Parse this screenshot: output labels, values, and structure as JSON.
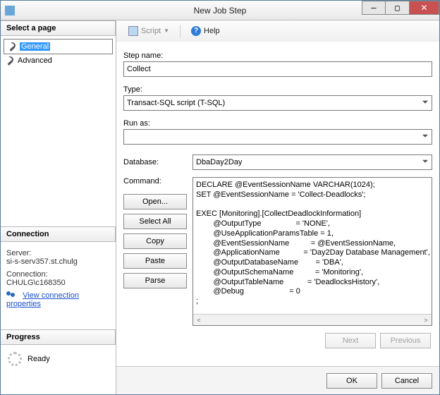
{
  "window": {
    "title": "New Job Step",
    "buttons": {
      "min": "—",
      "max": "▢",
      "close": "✕"
    }
  },
  "left": {
    "pages_header": "Select a page",
    "pages": [
      "General",
      "Advanced"
    ],
    "connection_header": "Connection",
    "server_label": "Server:",
    "server_value": "si-s-serv357.st.chulg",
    "conn_label": "Connection:",
    "conn_value": "CHULG\\c168350",
    "view_props": "View connection properties",
    "progress_header": "Progress",
    "progress_status": "Ready"
  },
  "toolbar": {
    "script": "Script",
    "help": "Help"
  },
  "form": {
    "step_name_label": "Step name:",
    "step_name_value": "Collect",
    "type_label": "Type:",
    "type_value": "Transact-SQL script (T-SQL)",
    "runas_label": "Run as:",
    "runas_value": "",
    "database_label": "Database:",
    "database_value": "DbaDay2Day",
    "command_label": "Command:",
    "buttons": {
      "open": "Open...",
      "select_all": "Select All",
      "copy": "Copy",
      "paste": "Paste",
      "parse": "Parse"
    },
    "command_text": "DECLARE @EventSessionName VARCHAR(1024);\nSET @EventSessionName = 'Collect-Deadlocks';\n\nEXEC [Monitoring].[CollectDeadlockInformation]\n        @OutputType                = 'NONE',\n        @UseApplicationParamsTable = 1,\n        @EventSessionName          = @EventSessionName,\n        @ApplicationName           = 'Day2Day Database Management',\n        @OutputDatabaseName        = 'DBA',\n        @OutputSchemaName          = 'Monitoring',\n        @OutputTableName           = 'DeadlocksHistory',\n        @Debug                     = 0\n;",
    "nav": {
      "next": "Next",
      "prev": "Previous"
    }
  },
  "footer": {
    "ok": "OK",
    "cancel": "Cancel"
  }
}
